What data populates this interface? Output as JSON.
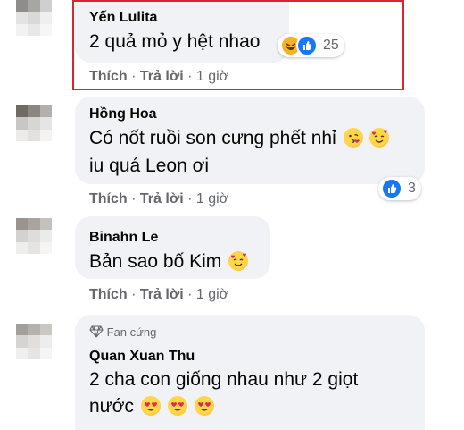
{
  "comments": [
    {
      "author": "Yến Lulita",
      "text_lines": [
        "2 quả mỏ y hệt nhao"
      ],
      "like_label": "Thích",
      "reply_label": "Trả lời",
      "time": "1 giờ",
      "reaction_count": "25",
      "reactions": [
        "haha-icon",
        "like-icon"
      ]
    },
    {
      "author": "Hồng Hoa",
      "text_lines": [
        "Có nốt ruồi son cưng phết nhỉ",
        "iu quá Leon ơi"
      ],
      "like_label": "Thích",
      "reply_label": "Trả lời",
      "time": "1 giờ",
      "reaction_count": "3",
      "reactions": [
        "like-icon"
      ]
    },
    {
      "author": "Binahn Le",
      "text_lines": [
        "Bản sao bố Kim"
      ],
      "like_label": "Thích",
      "reply_label": "Trả lời",
      "time": "1 giờ"
    },
    {
      "author": "Quan Xuan Thu",
      "badge": "Fan cứng",
      "text_lines": [
        "2 cha con giống nhau như 2 giọt",
        "nước"
      ]
    }
  ],
  "separator": "·",
  "colors": {
    "bubble": "#f0f2f5",
    "secondary_text": "#65676b",
    "highlight_border": "#d7262e",
    "like_blue": "#1877f2"
  }
}
